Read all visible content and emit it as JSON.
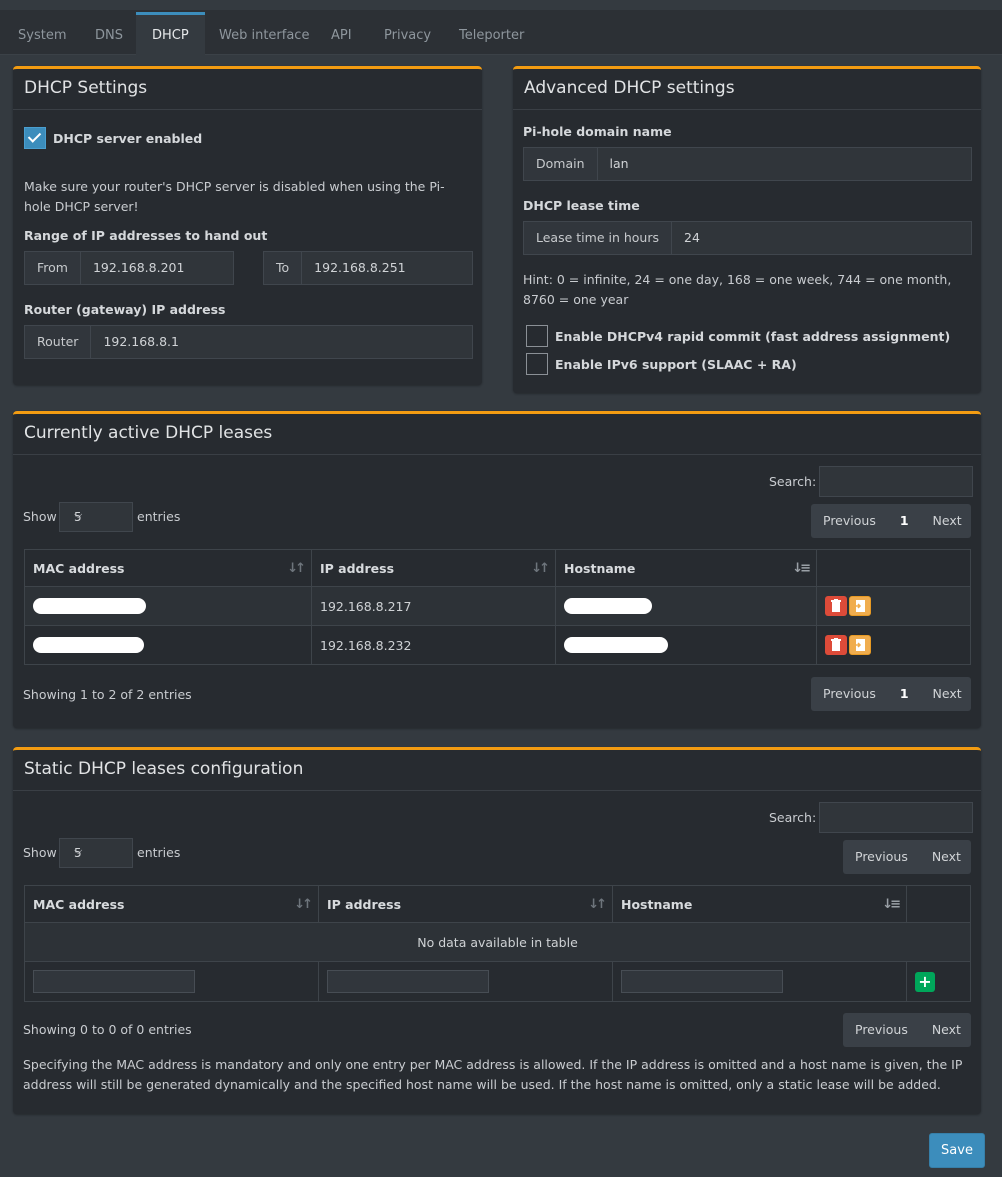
{
  "tabs": [
    {
      "label": "System"
    },
    {
      "label": "DNS"
    },
    {
      "label": "DHCP"
    },
    {
      "label": "Web interface"
    },
    {
      "label": "API"
    },
    {
      "label": "Privacy"
    },
    {
      "label": "Teleporter"
    }
  ],
  "dhcp_settings": {
    "title": "DHCP Settings",
    "enabled_label": "DHCP server enabled",
    "enabled": true,
    "warning": "Make sure your router's DHCP server is disabled when using the Pi-hole DHCP server!",
    "range_label": "Range of IP addresses to hand out",
    "from_addon": "From",
    "from_value": "192.168.8.201",
    "to_addon": "To",
    "to_value": "192.168.8.251",
    "router_label": "Router (gateway) IP address",
    "router_addon": "Router",
    "router_value": "192.168.8.1"
  },
  "advanced": {
    "title": "Advanced DHCP settings",
    "domain_label": "Pi-hole domain name",
    "domain_addon": "Domain",
    "domain_value": "lan",
    "lease_label": "DHCP lease time",
    "lease_addon": "Lease time in hours",
    "lease_value": "24",
    "hint": "Hint: 0 = infinite, 24 = one day, 168 = one week, 744 = one month, 8760 = one year",
    "rapid_commit_label": "Enable DHCPv4 rapid commit (fast address assignment)",
    "rapid_commit": false,
    "ipv6_label": "Enable IPv6 support (SLAAC + RA)",
    "ipv6": false
  },
  "active_leases": {
    "title": "Currently active DHCP leases",
    "search_label": "Search:",
    "show_label": "Show",
    "entries_label": "entries",
    "page_size": "5",
    "previous": "Previous",
    "page": "1",
    "next": "Next",
    "columns": [
      "MAC address",
      "IP address",
      "Hostname"
    ],
    "rows": [
      {
        "mac": "",
        "ip": "192.168.8.217",
        "hostname": ""
      },
      {
        "mac": "",
        "ip": "192.168.8.232",
        "hostname": ""
      }
    ],
    "info": "Showing 1 to 2 of 2 entries"
  },
  "static_leases": {
    "title": "Static DHCP leases configuration",
    "search_label": "Search:",
    "show_label": "Show",
    "entries_label": "entries",
    "page_size": "5",
    "previous": "Previous",
    "next": "Next",
    "columns": [
      "MAC address",
      "IP address",
      "Hostname"
    ],
    "empty": "No data available in table",
    "info": "Showing 0 to 0 of 0 entries",
    "note": "Specifying the MAC address is mandatory and only one entry per MAC address is allowed. If the IP address is omitted and a host name is given, the IP address will still be generated dynamically and the specified host name will be used. If the host name is omitted, only a static lease will be added."
  },
  "save_label": "Save",
  "colors": {
    "accent": "#3c8dbc",
    "box_border": "#f39c12",
    "delete": "#dd4b39",
    "copy": "#f0ad4e",
    "add": "#00a65a"
  }
}
